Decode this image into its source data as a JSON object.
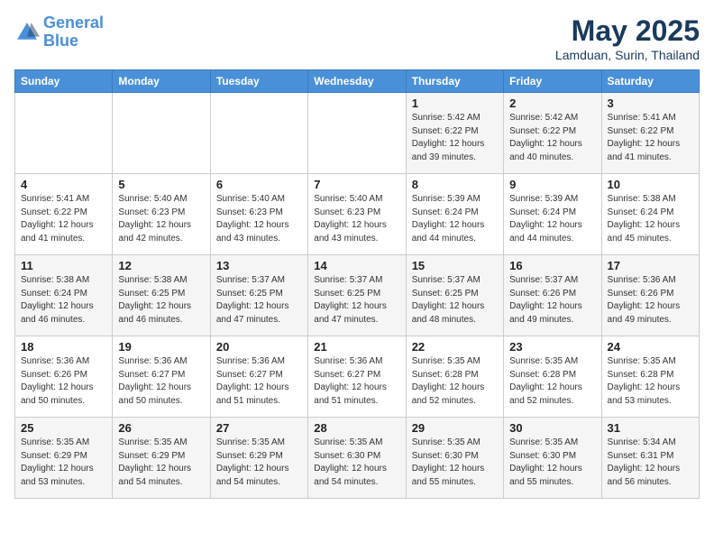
{
  "header": {
    "logo_line1": "General",
    "logo_line2": "Blue",
    "month_title": "May 2025",
    "location": "Lamduan, Surin, Thailand"
  },
  "days_of_week": [
    "Sunday",
    "Monday",
    "Tuesday",
    "Wednesday",
    "Thursday",
    "Friday",
    "Saturday"
  ],
  "weeks": [
    [
      {
        "num": "",
        "info": ""
      },
      {
        "num": "",
        "info": ""
      },
      {
        "num": "",
        "info": ""
      },
      {
        "num": "",
        "info": ""
      },
      {
        "num": "1",
        "info": "Sunrise: 5:42 AM\nSunset: 6:22 PM\nDaylight: 12 hours\nand 39 minutes."
      },
      {
        "num": "2",
        "info": "Sunrise: 5:42 AM\nSunset: 6:22 PM\nDaylight: 12 hours\nand 40 minutes."
      },
      {
        "num": "3",
        "info": "Sunrise: 5:41 AM\nSunset: 6:22 PM\nDaylight: 12 hours\nand 41 minutes."
      }
    ],
    [
      {
        "num": "4",
        "info": "Sunrise: 5:41 AM\nSunset: 6:22 PM\nDaylight: 12 hours\nand 41 minutes."
      },
      {
        "num": "5",
        "info": "Sunrise: 5:40 AM\nSunset: 6:23 PM\nDaylight: 12 hours\nand 42 minutes."
      },
      {
        "num": "6",
        "info": "Sunrise: 5:40 AM\nSunset: 6:23 PM\nDaylight: 12 hours\nand 43 minutes."
      },
      {
        "num": "7",
        "info": "Sunrise: 5:40 AM\nSunset: 6:23 PM\nDaylight: 12 hours\nand 43 minutes."
      },
      {
        "num": "8",
        "info": "Sunrise: 5:39 AM\nSunset: 6:24 PM\nDaylight: 12 hours\nand 44 minutes."
      },
      {
        "num": "9",
        "info": "Sunrise: 5:39 AM\nSunset: 6:24 PM\nDaylight: 12 hours\nand 44 minutes."
      },
      {
        "num": "10",
        "info": "Sunrise: 5:38 AM\nSunset: 6:24 PM\nDaylight: 12 hours\nand 45 minutes."
      }
    ],
    [
      {
        "num": "11",
        "info": "Sunrise: 5:38 AM\nSunset: 6:24 PM\nDaylight: 12 hours\nand 46 minutes."
      },
      {
        "num": "12",
        "info": "Sunrise: 5:38 AM\nSunset: 6:25 PM\nDaylight: 12 hours\nand 46 minutes."
      },
      {
        "num": "13",
        "info": "Sunrise: 5:37 AM\nSunset: 6:25 PM\nDaylight: 12 hours\nand 47 minutes."
      },
      {
        "num": "14",
        "info": "Sunrise: 5:37 AM\nSunset: 6:25 PM\nDaylight: 12 hours\nand 47 minutes."
      },
      {
        "num": "15",
        "info": "Sunrise: 5:37 AM\nSunset: 6:25 PM\nDaylight: 12 hours\nand 48 minutes."
      },
      {
        "num": "16",
        "info": "Sunrise: 5:37 AM\nSunset: 6:26 PM\nDaylight: 12 hours\nand 49 minutes."
      },
      {
        "num": "17",
        "info": "Sunrise: 5:36 AM\nSunset: 6:26 PM\nDaylight: 12 hours\nand 49 minutes."
      }
    ],
    [
      {
        "num": "18",
        "info": "Sunrise: 5:36 AM\nSunset: 6:26 PM\nDaylight: 12 hours\nand 50 minutes."
      },
      {
        "num": "19",
        "info": "Sunrise: 5:36 AM\nSunset: 6:27 PM\nDaylight: 12 hours\nand 50 minutes."
      },
      {
        "num": "20",
        "info": "Sunrise: 5:36 AM\nSunset: 6:27 PM\nDaylight: 12 hours\nand 51 minutes."
      },
      {
        "num": "21",
        "info": "Sunrise: 5:36 AM\nSunset: 6:27 PM\nDaylight: 12 hours\nand 51 minutes."
      },
      {
        "num": "22",
        "info": "Sunrise: 5:35 AM\nSunset: 6:28 PM\nDaylight: 12 hours\nand 52 minutes."
      },
      {
        "num": "23",
        "info": "Sunrise: 5:35 AM\nSunset: 6:28 PM\nDaylight: 12 hours\nand 52 minutes."
      },
      {
        "num": "24",
        "info": "Sunrise: 5:35 AM\nSunset: 6:28 PM\nDaylight: 12 hours\nand 53 minutes."
      }
    ],
    [
      {
        "num": "25",
        "info": "Sunrise: 5:35 AM\nSunset: 6:29 PM\nDaylight: 12 hours\nand 53 minutes."
      },
      {
        "num": "26",
        "info": "Sunrise: 5:35 AM\nSunset: 6:29 PM\nDaylight: 12 hours\nand 54 minutes."
      },
      {
        "num": "27",
        "info": "Sunrise: 5:35 AM\nSunset: 6:29 PM\nDaylight: 12 hours\nand 54 minutes."
      },
      {
        "num": "28",
        "info": "Sunrise: 5:35 AM\nSunset: 6:30 PM\nDaylight: 12 hours\nand 54 minutes."
      },
      {
        "num": "29",
        "info": "Sunrise: 5:35 AM\nSunset: 6:30 PM\nDaylight: 12 hours\nand 55 minutes."
      },
      {
        "num": "30",
        "info": "Sunrise: 5:35 AM\nSunset: 6:30 PM\nDaylight: 12 hours\nand 55 minutes."
      },
      {
        "num": "31",
        "info": "Sunrise: 5:34 AM\nSunset: 6:31 PM\nDaylight: 12 hours\nand 56 minutes."
      }
    ]
  ]
}
